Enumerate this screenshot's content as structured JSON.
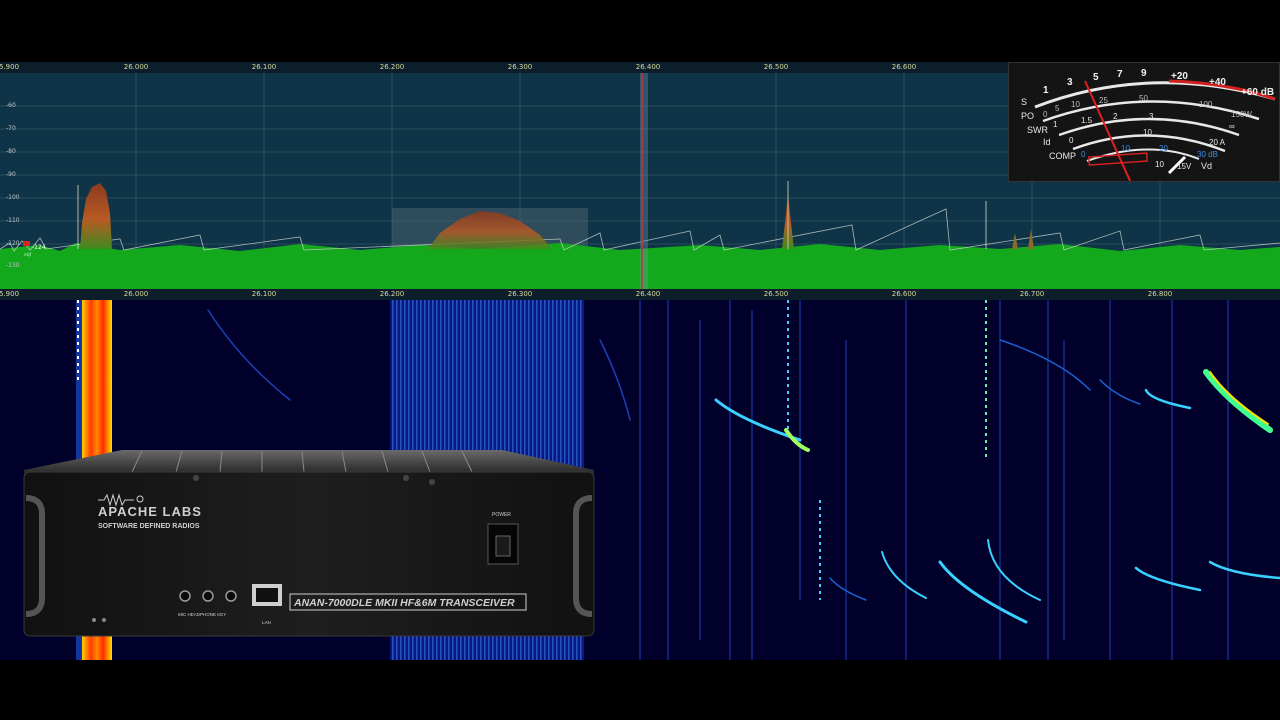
{
  "panadapter": {
    "top_freq_labels": [
      "5.900",
      "26.000",
      "26.100",
      "26.200",
      "26.300",
      "26.400",
      "26.500",
      "26.600"
    ],
    "bottom_freq_labels": [
      "5.900",
      "26.000",
      "26.100",
      "26.200",
      "26.300",
      "26.400",
      "26.500",
      "26.600",
      "26.700",
      "26.800"
    ],
    "db_labels": [
      "-60",
      "-70",
      "-80",
      "-90",
      "-100",
      "-110",
      "-120",
      "-130"
    ],
    "noise_floor_value": "-124",
    "squelch_label": "sql",
    "colors": {
      "background": "#0f3447",
      "spectrum_fill": "#14a81c",
      "signal_peak": "#b04a22",
      "tuning_marker": "#d03030"
    }
  },
  "smeter": {
    "scales": {
      "s_label": "S",
      "po_label": "PO",
      "swr_label": "SWR",
      "id_label": "Id",
      "comp_label": "COMP",
      "vd_label": "Vd"
    },
    "s_ticks": [
      "1",
      "3",
      "5",
      "7",
      "9",
      "+20",
      "+40",
      "+60 dB"
    ],
    "po_ticks": [
      "0",
      "5",
      "10",
      "25",
      "50",
      "100",
      "150W"
    ],
    "swr_ticks": [
      "1",
      "1.5",
      "2",
      "3",
      "∞"
    ],
    "id_ticks": [
      "0",
      "10",
      "20 A"
    ],
    "comp_ticks": [
      "0",
      "10",
      "20",
      "30 dB"
    ],
    "vd_ticks": [
      "10",
      "15V"
    ]
  },
  "radio": {
    "brand": "APACHE LABS",
    "tagline": "SOFTWARE DEFINED RADIOS",
    "model": "ANAN-7000DLE MKII HF&6M TRANSCEIVER",
    "power_label": "POWER",
    "jack_labels": "MIC HEADPHONE KEY",
    "lan_label": "LAN"
  }
}
